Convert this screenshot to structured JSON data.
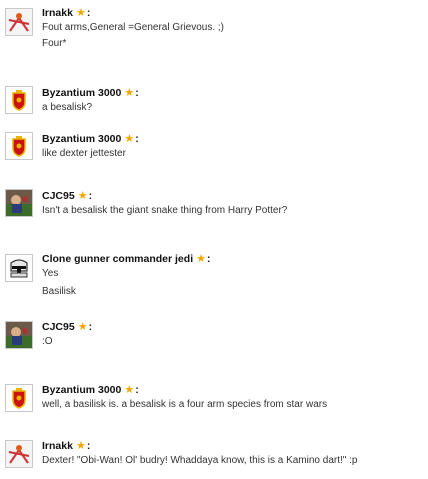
{
  "posts": [
    {
      "user": "Irnakk",
      "avatar": "irnakk-avatar",
      "lines": [
        "Fout arms,General =General Grievous. ;)",
        "Four*"
      ]
    },
    {
      "user": "Byzantium 3000",
      "avatar": "crest-avatar",
      "lines": [
        "a besalisk?"
      ]
    },
    {
      "user": "Byzantium 3000",
      "avatar": "crest-avatar",
      "lines": [
        "like dexter jettester"
      ]
    },
    {
      "user": "CJC95",
      "avatar": "cjc95-avatar",
      "lines": [
        "Isn't a besalisk the giant snake thing from Harry Potter?"
      ]
    },
    {
      "user": "Clone gunner commander jedi",
      "avatar": "clone-avatar",
      "lines": [
        "Yes",
        "Basilisk"
      ]
    },
    {
      "user": "CJC95",
      "avatar": "cjc95-avatar",
      "lines": [
        ":O"
      ]
    },
    {
      "user": "Byzantium 3000",
      "avatar": "crest-avatar",
      "lines": [
        "well, a basilisk is. a besalisk is a four arm species from star wars"
      ]
    },
    {
      "user": "Irnakk",
      "avatar": "irnakk-avatar",
      "lines": [
        "Dexter! \"Obi-Wan! Ol' budry! Whaddaya know, this is a Kamino dart!\" :p"
      ]
    }
  ],
  "colors": {
    "star": "#f2a500",
    "crest_red": "#cc1111",
    "crest_gold": "#e8b400"
  }
}
